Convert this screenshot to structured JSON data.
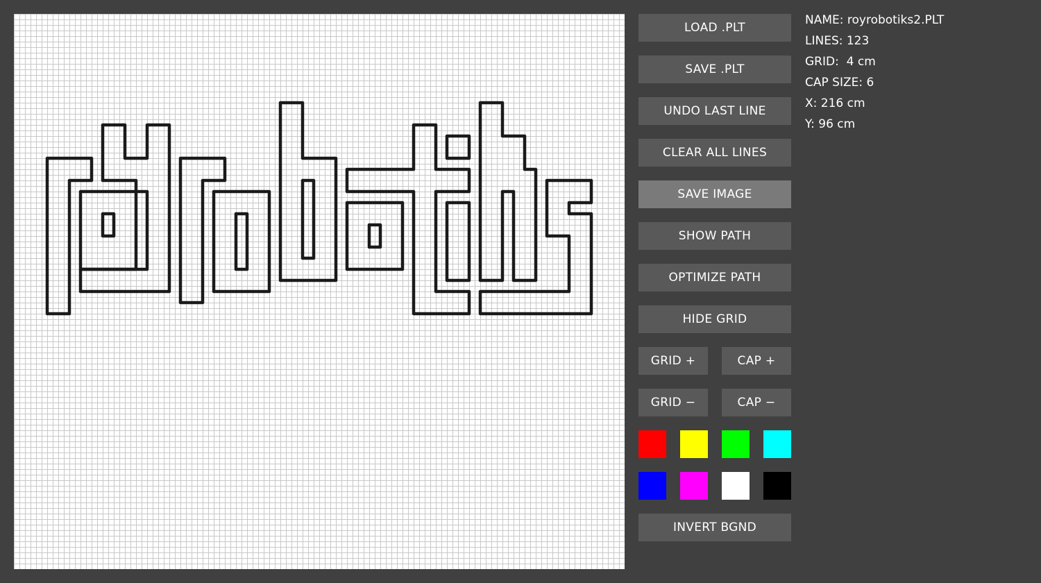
{
  "toolbar": {
    "load": "LOAD .PLT",
    "save": "SAVE .PLT",
    "undo": "UNDO LAST LINE",
    "clear": "CLEAR ALL LINES",
    "save_image": "SAVE IMAGE",
    "show_path": "SHOW PATH",
    "optimize_path": "OPTIMIZE PATH",
    "hide_grid": "HIDE GRID",
    "grid_plus": "GRID +",
    "cap_plus": "CAP +",
    "grid_minus": "GRID −",
    "cap_minus": "CAP −",
    "invert_bgnd": "INVERT BGND"
  },
  "info": {
    "name": "NAME: royrobotiks2.PLT",
    "lines": "LINES: 123",
    "grid": "GRID:  4 cm",
    "cap_size": "CAP SIZE: 6",
    "x": "X: 216 cm",
    "y": "Y: 96 cm"
  },
  "palette": [
    {
      "name": "red",
      "color": "#ff0000"
    },
    {
      "name": "yellow",
      "color": "#ffff00"
    },
    {
      "name": "green",
      "color": "#00ff00"
    },
    {
      "name": "cyan",
      "color": "#00ffff"
    },
    {
      "name": "blue",
      "color": "#0000ff"
    },
    {
      "name": "magenta",
      "color": "#ff00ff"
    },
    {
      "name": "white",
      "color": "#ffffff"
    },
    {
      "name": "black",
      "color": "#000000"
    }
  ],
  "colors": {
    "background": "#404040",
    "button": "#595959",
    "button_active": "#7a7a7a",
    "grid_line": "#c8c8c8",
    "stroke": "#1a1a1a"
  }
}
